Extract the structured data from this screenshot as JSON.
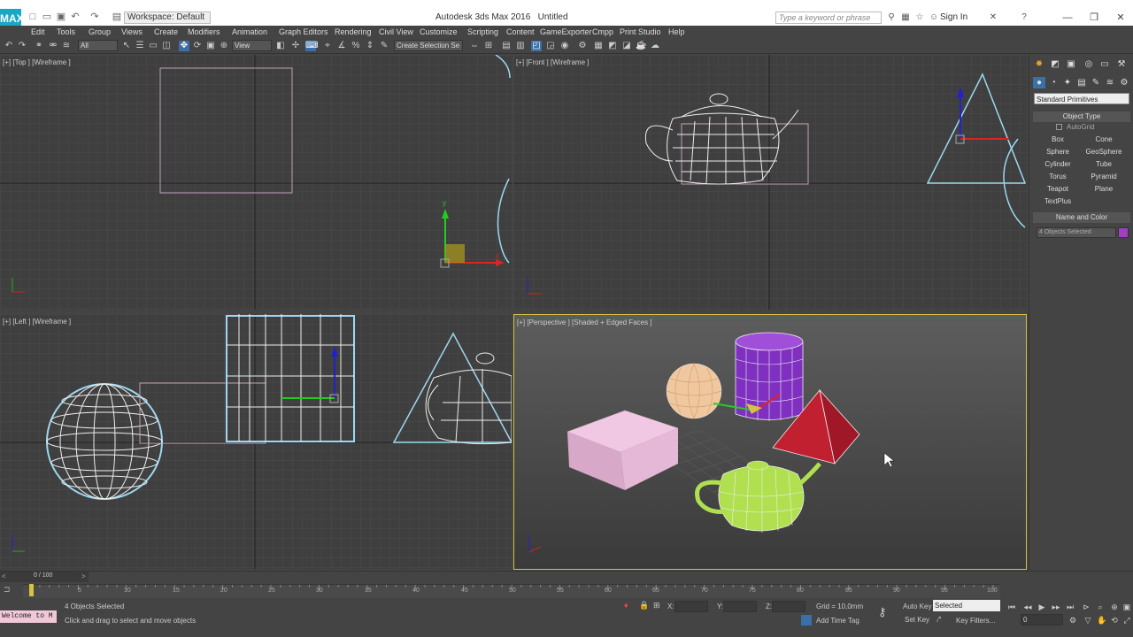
{
  "app": {
    "title": "Autodesk 3ds Max 2016",
    "doc": "Untitled",
    "workspace": "Workspace: Default",
    "search_placeholder": "Type a keyword or phrase",
    "sign_in": "Sign In",
    "logo": "MAX"
  },
  "menu": [
    "Edit",
    "Tools",
    "Group",
    "Views",
    "Create",
    "Modifiers",
    "Animation",
    "Graph Editors",
    "Rendering",
    "Civil View",
    "Customize",
    "Scripting",
    "Content",
    "GameExporter",
    "Cmpp",
    "Print Studio",
    "Help"
  ],
  "toolbar": {
    "filter": "All",
    "ref_coord": "View",
    "selection_set": "Create Selection Se"
  },
  "viewports": {
    "top": "[+] [Top ] [Wireframe ]",
    "front": "[+] [Front ] [Wireframe ]",
    "left": "[+] [Left ] [Wireframe ]",
    "persp": "[+] [Perspective ] [Shaded + Edged Faces ]"
  },
  "cmdpanel": {
    "category": "Standard Primitives",
    "object_type": "Object Type",
    "autogrid": "AutoGrid",
    "buttons": [
      "Box",
      "Cone",
      "Sphere",
      "GeoSphere",
      "Cylinder",
      "Tube",
      "Torus",
      "Pyramid",
      "Teapot",
      "Plane",
      "TextPlus"
    ],
    "name_color": "Name and Color",
    "name_value": "4 Objects Selected",
    "color": "#a040c0"
  },
  "timeline": {
    "frame": "0 / 100",
    "ticks": [
      "0",
      "5",
      "10",
      "15",
      "20",
      "25",
      "30",
      "35",
      "40",
      "45",
      "50",
      "55",
      "60",
      "65",
      "70",
      "75",
      "80",
      "85",
      "90",
      "95",
      "100"
    ]
  },
  "status": {
    "maxscript": "Welcome to M",
    "selected": "4 Objects Selected",
    "prompt": "Click and drag to select and move objects",
    "x_label": "X:",
    "y_label": "Y:",
    "z_label": "Z:",
    "grid": "Grid = 10,0mm",
    "add_time_tag": "Add Time Tag",
    "auto_key": "Auto Key",
    "set_key": "Set Key",
    "key_mode": "Selected",
    "key_filters": "Key Filters...",
    "frame_field": "0"
  }
}
